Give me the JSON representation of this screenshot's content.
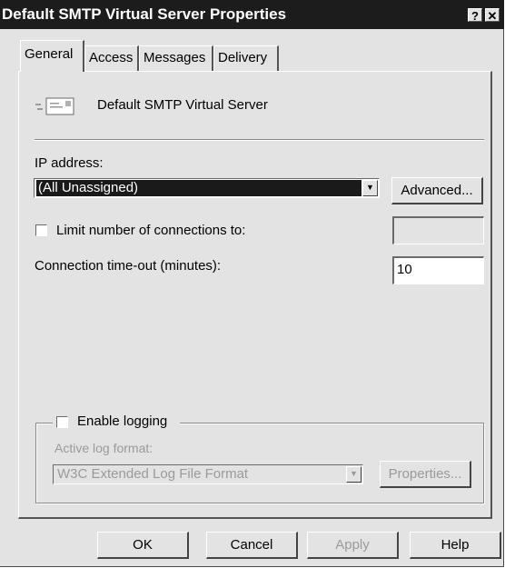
{
  "window": {
    "title": "Default SMTP Virtual Server Properties",
    "help_glyph": "?",
    "close_glyph": "✕"
  },
  "tabs": [
    {
      "label": "General"
    },
    {
      "label": "Access"
    },
    {
      "label": "Messages"
    },
    {
      "label": "Delivery"
    }
  ],
  "general": {
    "server_name": "Default SMTP Virtual Server",
    "server_icon": "envelope-icon",
    "ip_label": "IP address:",
    "ip_value": "(All Unassigned)",
    "advanced_label": "Advanced...",
    "limit_label": "Limit number of connections to:",
    "limit_value": "",
    "timeout_label": "Connection time-out (minutes):",
    "timeout_value": "10",
    "logging_label": "Enable logging",
    "log_format_label": "Active log format:",
    "log_format_value": "W3C Extended Log File Format",
    "properties_label": "Properties..."
  },
  "footer": {
    "ok": "OK",
    "cancel": "Cancel",
    "apply": "Apply",
    "help": "Help"
  }
}
